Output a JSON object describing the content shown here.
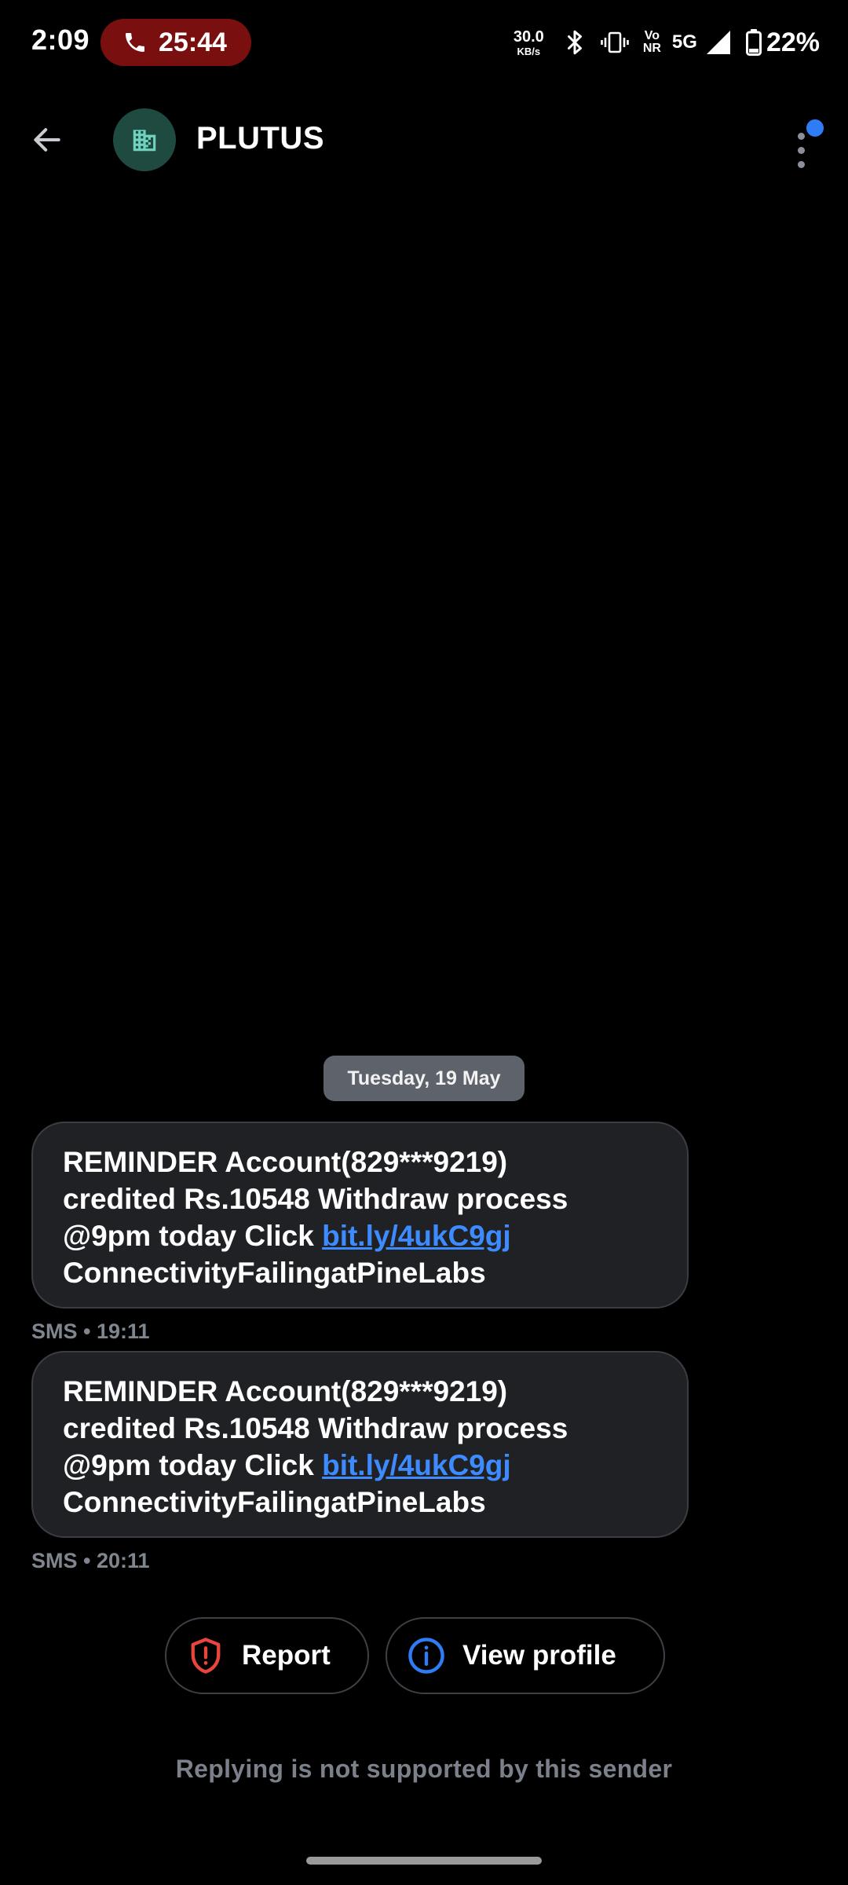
{
  "status_bar": {
    "time": "2:09",
    "call_timer": "25:44",
    "net_speed_value": "30.0",
    "net_speed_unit": "KB/s",
    "volte_top": "Vo",
    "volte_bottom": "NR",
    "network_type": "5G",
    "battery_percent": "22%",
    "icons": [
      "phone-icon",
      "bluetooth-icon",
      "vibrate-icon",
      "signal-icon",
      "battery-icon"
    ]
  },
  "header": {
    "contact_name": "PLUTUS",
    "avatar_icon": "building-icon",
    "back_icon": "back-arrow-icon",
    "menu_icon": "more-vert-icon",
    "accent_color": "#2f7df6"
  },
  "conversation": {
    "date_label": "Tuesday, 19 May",
    "messages": [
      {
        "line1": "REMINDER Account(829***9219)",
        "line2": "credited Rs.10548 Withdraw process",
        "line3_prefix": "@9pm today Click ",
        "link": "bit.ly/4ukC9gj",
        "line4": "ConnectivityFailingatPineLabs",
        "meta": "SMS • 19:11"
      },
      {
        "line1": "REMINDER Account(829***9219)",
        "line2": "credited Rs.10548 Withdraw process",
        "line3_prefix": "@9pm today Click ",
        "link": "bit.ly/4ukC9gj",
        "line4": "ConnectivityFailingatPineLabs",
        "meta": "SMS • 20:11"
      }
    ]
  },
  "actions": {
    "report_label": "Report",
    "report_icon": "shield-alert-icon",
    "report_color": "#e8453c",
    "profile_label": "View profile",
    "profile_icon": "info-icon",
    "profile_color": "#2f7df6"
  },
  "footer": {
    "reply_note": "Replying is not supported by this sender"
  }
}
